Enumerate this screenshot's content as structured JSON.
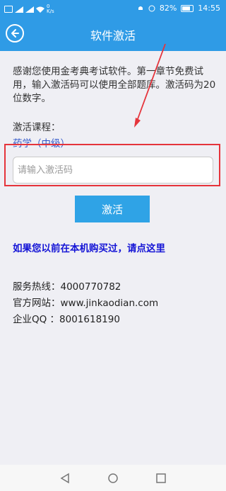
{
  "status_bar": {
    "left_icons": [
      "sim-icon",
      "signal-icon",
      "signal-icon",
      "wifi-icon"
    ],
    "net_speed": "0\nK/s",
    "battery": "82%",
    "time": "14:55",
    "right_icons": [
      "bell-icon",
      "alarm-icon",
      "battery-icon"
    ]
  },
  "header": {
    "title": "软件激活",
    "back_icon": "back-icon"
  },
  "content": {
    "intro": "感谢您使用金考典考试软件。第一章节免费试用，输入激活码可以使用全部题库。激活码为20位数字。",
    "course_label": "激活课程：",
    "course_name": "药学（中级）",
    "input_placeholder": "请输入激活码",
    "activate_label": "激活",
    "purchased_link": "如果您以前在本机购买过，请点这里",
    "contacts": {
      "hotline": "服务热线：4000770782",
      "website": "官方网站：www.jinkaodian.com",
      "qq": "企业QQ ：8001618190"
    }
  },
  "annotation": {
    "highlight_color": "#e5343b",
    "arrow_color": "#e5343b"
  },
  "navbar": {
    "back": "back-icon",
    "home": "home-icon",
    "recent": "recent-apps-icon"
  }
}
